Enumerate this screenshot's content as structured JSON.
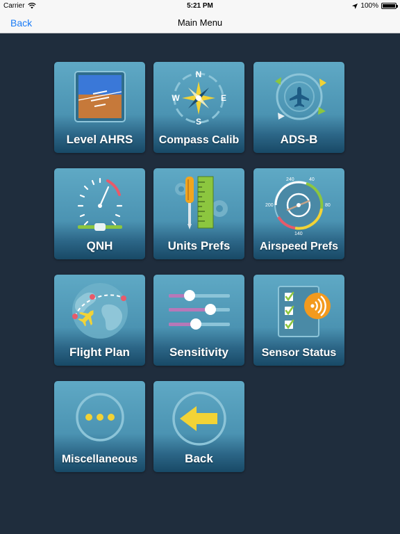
{
  "status_bar": {
    "carrier": "Carrier",
    "time": "5:21 PM",
    "battery": "100%"
  },
  "nav_bar": {
    "back_label": "Back",
    "title": "Main Menu"
  },
  "menu": {
    "items": [
      {
        "label": "Level AHRS",
        "icon": "attitude-indicator-icon"
      },
      {
        "label": "Compass Calib",
        "icon": "compass-icon"
      },
      {
        "label": "ADS-B",
        "icon": "adsb-airplane-icon"
      },
      {
        "label": "QNH",
        "icon": "altimeter-icon"
      },
      {
        "label": "Units Prefs",
        "icon": "ruler-screwdriver-icon"
      },
      {
        "label": "Airspeed Prefs",
        "icon": "airspeed-gauge-icon"
      },
      {
        "label": "Flight Plan",
        "icon": "globe-airplane-icon"
      },
      {
        "label": "Sensitivity",
        "icon": "sliders-icon"
      },
      {
        "label": "Sensor Status",
        "icon": "checklist-signal-icon"
      },
      {
        "label": "Miscellaneous",
        "icon": "ellipsis-icon"
      },
      {
        "label": "Back",
        "icon": "back-arrow-icon"
      }
    ]
  },
  "compass": {
    "n": "N",
    "e": "E",
    "s": "S",
    "w": "W"
  },
  "airspeed": {
    "t240": "240",
    "t40": "40",
    "t200": "200",
    "t80": "80",
    "t140": "140"
  },
  "colors": {
    "accent": "#1a7bf6",
    "background": "#1f2d3d",
    "tile_top": "#5fa9c5",
    "tile_bottom": "#184966"
  }
}
